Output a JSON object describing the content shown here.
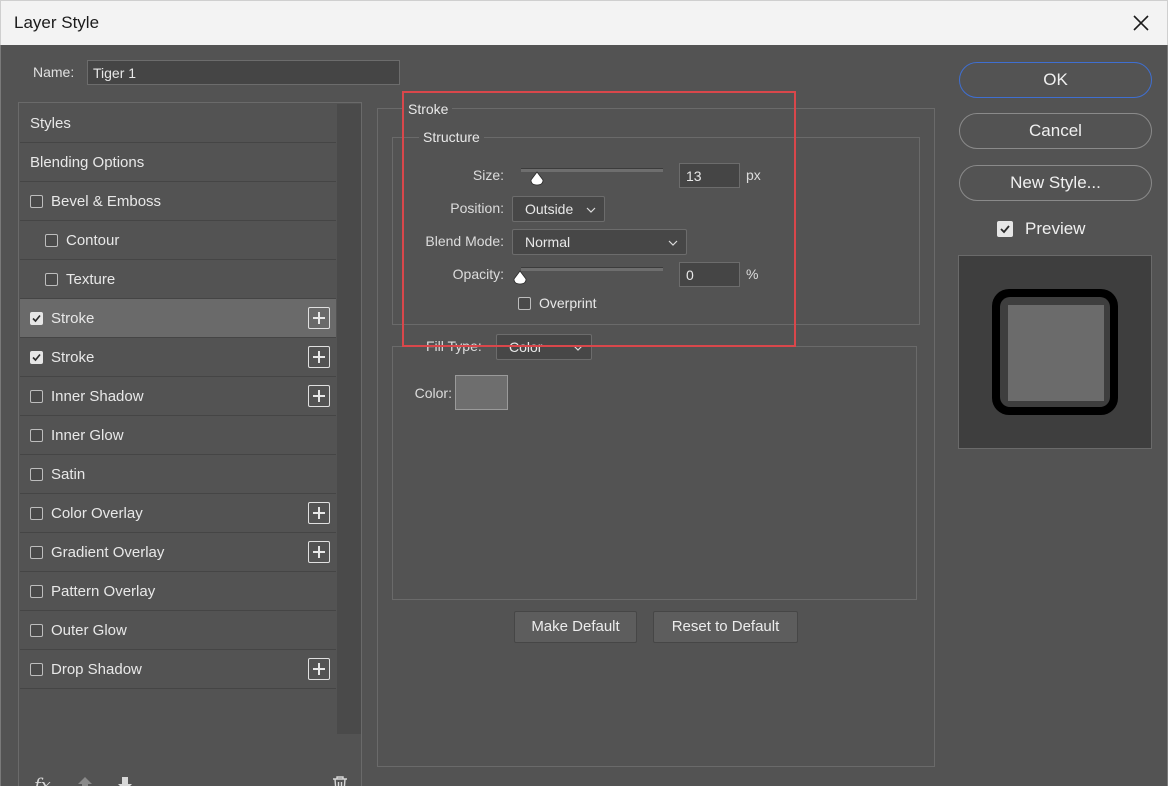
{
  "window": {
    "title": "Layer Style"
  },
  "name_field": {
    "label": "Name:",
    "value": "Tiger 1"
  },
  "left_list": [
    {
      "label": "Styles",
      "checkbox": false,
      "indent": false,
      "selected": false,
      "plus": false
    },
    {
      "label": "Blending Options",
      "checkbox": false,
      "indent": false,
      "selected": false,
      "plus": false
    },
    {
      "label": "Bevel & Emboss",
      "checkbox": true,
      "checked": false,
      "indent": false,
      "plus": false
    },
    {
      "label": "Contour",
      "checkbox": true,
      "checked": false,
      "indent": true,
      "plus": false
    },
    {
      "label": "Texture",
      "checkbox": true,
      "checked": false,
      "indent": true,
      "plus": false
    },
    {
      "label": "Stroke",
      "checkbox": true,
      "checked": true,
      "indent": false,
      "selected": true,
      "plus": true
    },
    {
      "label": "Stroke",
      "checkbox": true,
      "checked": true,
      "indent": false,
      "plus": true
    },
    {
      "label": "Inner Shadow",
      "checkbox": true,
      "checked": false,
      "indent": false,
      "plus": true
    },
    {
      "label": "Inner Glow",
      "checkbox": true,
      "checked": false,
      "indent": false,
      "plus": false
    },
    {
      "label": "Satin",
      "checkbox": true,
      "checked": false,
      "indent": false,
      "plus": false
    },
    {
      "label": "Color Overlay",
      "checkbox": true,
      "checked": false,
      "indent": false,
      "plus": true
    },
    {
      "label": "Gradient Overlay",
      "checkbox": true,
      "checked": false,
      "indent": false,
      "plus": true
    },
    {
      "label": "Pattern Overlay",
      "checkbox": true,
      "checked": false,
      "indent": false,
      "plus": false
    },
    {
      "label": "Outer Glow",
      "checkbox": true,
      "checked": false,
      "indent": false,
      "plus": false
    },
    {
      "label": "Drop Shadow",
      "checkbox": true,
      "checked": false,
      "indent": false,
      "plus": true
    }
  ],
  "left_footer": {
    "fx_label": "fx"
  },
  "stroke": {
    "title": "Stroke",
    "structure_title": "Structure",
    "size_label": "Size:",
    "size_value": "13",
    "size_unit": "px",
    "position_label": "Position:",
    "position_value": "Outside",
    "blend_mode_label": "Blend Mode:",
    "blend_mode_value": "Normal",
    "opacity_label": "Opacity:",
    "opacity_value": "0",
    "opacity_unit": "%",
    "overprint_label": "Overprint",
    "fill_type_label": "Fill Type:",
    "fill_type_value": "Color",
    "color_label": "Color:",
    "make_default": "Make Default",
    "reset_default": "Reset to Default"
  },
  "right": {
    "ok": "OK",
    "cancel": "Cancel",
    "new_style": "New Style...",
    "preview_label": "Preview"
  },
  "colors": {
    "dialog_bg": "#535353",
    "highlight": "#d9474b",
    "ok_border": "#3f6fd1"
  }
}
